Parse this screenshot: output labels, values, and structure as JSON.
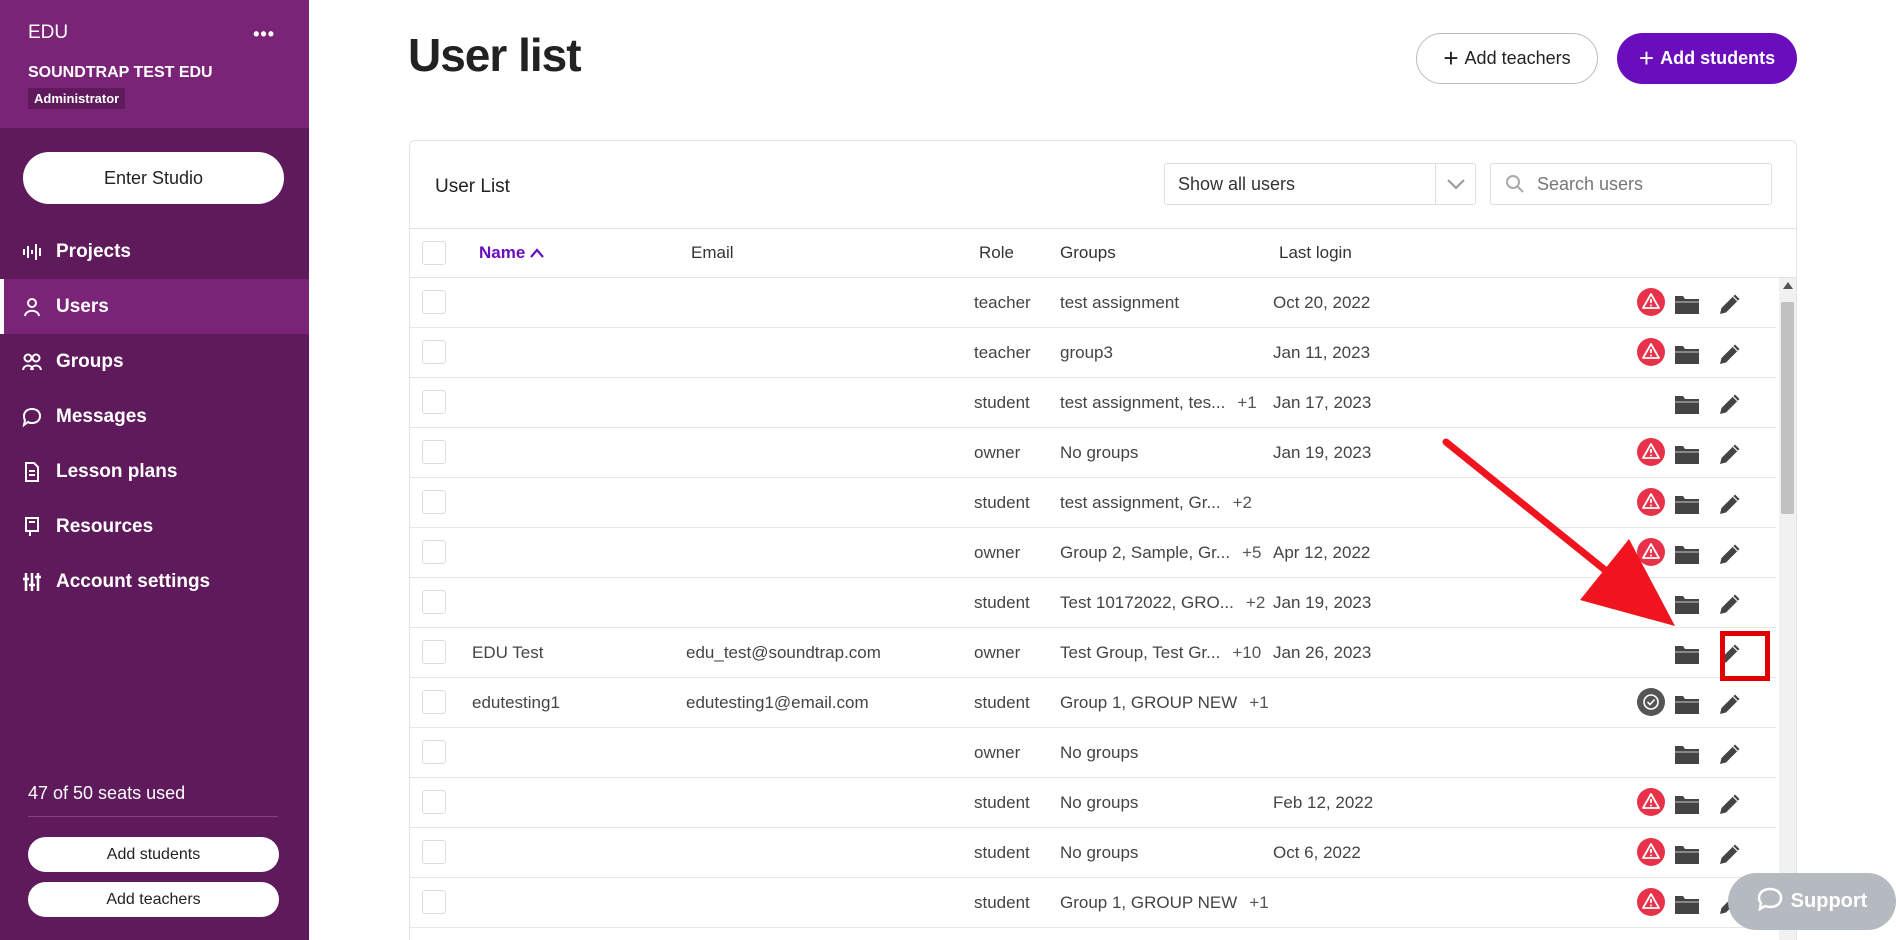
{
  "sidebar": {
    "org": "EDU",
    "more_label": "•••",
    "school": "SOUNDTRAP TEST EDU",
    "role_badge": "Administrator",
    "enter_studio": "Enter Studio",
    "items": [
      {
        "label": "Projects",
        "icon": "projects-icon"
      },
      {
        "label": "Users",
        "icon": "users-icon",
        "active": true
      },
      {
        "label": "Groups",
        "icon": "groups-icon"
      },
      {
        "label": "Messages",
        "icon": "messages-icon"
      },
      {
        "label": "Lesson plans",
        "icon": "lesson-plans-icon"
      },
      {
        "label": "Resources",
        "icon": "resources-icon"
      },
      {
        "label": "Account settings",
        "icon": "account-settings-icon"
      }
    ],
    "seats": "47 of 50 seats used",
    "add_students": "Add students",
    "add_teachers": "Add teachers"
  },
  "header": {
    "title": "User list",
    "add_teachers": "Add teachers",
    "add_students": "Add students"
  },
  "card": {
    "title": "User List",
    "filter_value": "Show all users",
    "search_placeholder": "Search users"
  },
  "table": {
    "columns": {
      "name": "Name",
      "email": "Email",
      "role": "Role",
      "groups": "Groups",
      "last_login": "Last login"
    },
    "rows": [
      {
        "name": "",
        "email": "",
        "role": "teacher",
        "groups": "test assignment",
        "more": "",
        "last_login": "Oct 20, 2022",
        "status": "warning"
      },
      {
        "name": "",
        "email": "",
        "role": "teacher",
        "groups": "group3",
        "more": "",
        "last_login": "Jan 11, 2023",
        "status": "warning"
      },
      {
        "name": "",
        "email": "",
        "role": "student",
        "groups": "test assignment, tes...",
        "more": "+1",
        "last_login": "Jan 17, 2023",
        "status": "none"
      },
      {
        "name": "",
        "email": "",
        "role": "owner",
        "groups": "No groups",
        "more": "",
        "last_login": "Jan 19, 2023",
        "status": "warning"
      },
      {
        "name": "",
        "email": "",
        "role": "student",
        "groups": "test assignment, Gr...",
        "more": "+2",
        "last_login": "",
        "status": "warning"
      },
      {
        "name": "",
        "email": "",
        "role": "owner",
        "groups": "Group 2, Sample, Gr...",
        "more": "+5",
        "last_login": "Apr 12, 2022",
        "status": "warning"
      },
      {
        "name": "",
        "email": "",
        "role": "student",
        "groups": "Test 10172022, GRO...",
        "more": "+2",
        "last_login": "Jan 19, 2023",
        "status": "none"
      },
      {
        "name": "EDU Test",
        "email": "edu_test@soundtrap.com",
        "role": "owner",
        "groups": "Test Group, Test Gr...",
        "more": "+10",
        "last_login": "Jan 26, 2023",
        "status": "none",
        "highlighted": true
      },
      {
        "name": "edutesting1",
        "email": "edutesting1@email.com",
        "role": "student",
        "groups": "Group 1, GROUP NEW",
        "more": "+1",
        "last_login": "",
        "status": "check"
      },
      {
        "name": "",
        "email": "",
        "role": "owner",
        "groups": "No groups",
        "more": "",
        "last_login": "",
        "status": "none"
      },
      {
        "name": "",
        "email": "",
        "role": "student",
        "groups": "No groups",
        "more": "",
        "last_login": "Feb 12, 2022",
        "status": "warning"
      },
      {
        "name": "",
        "email": "",
        "role": "student",
        "groups": "No groups",
        "more": "",
        "last_login": "Oct 6, 2022",
        "status": "warning"
      },
      {
        "name": "",
        "email": "",
        "role": "student",
        "groups": "Group 1, GROUP NEW",
        "more": "+1",
        "last_login": "",
        "status": "warning"
      }
    ]
  },
  "support": {
    "label": "Support"
  },
  "colors": {
    "sidebar": "#5f1a5c",
    "sidebar_active": "#7a2478",
    "accent": "#6a0dbd",
    "warning": "#e8324a",
    "highlight": "#e00000"
  }
}
